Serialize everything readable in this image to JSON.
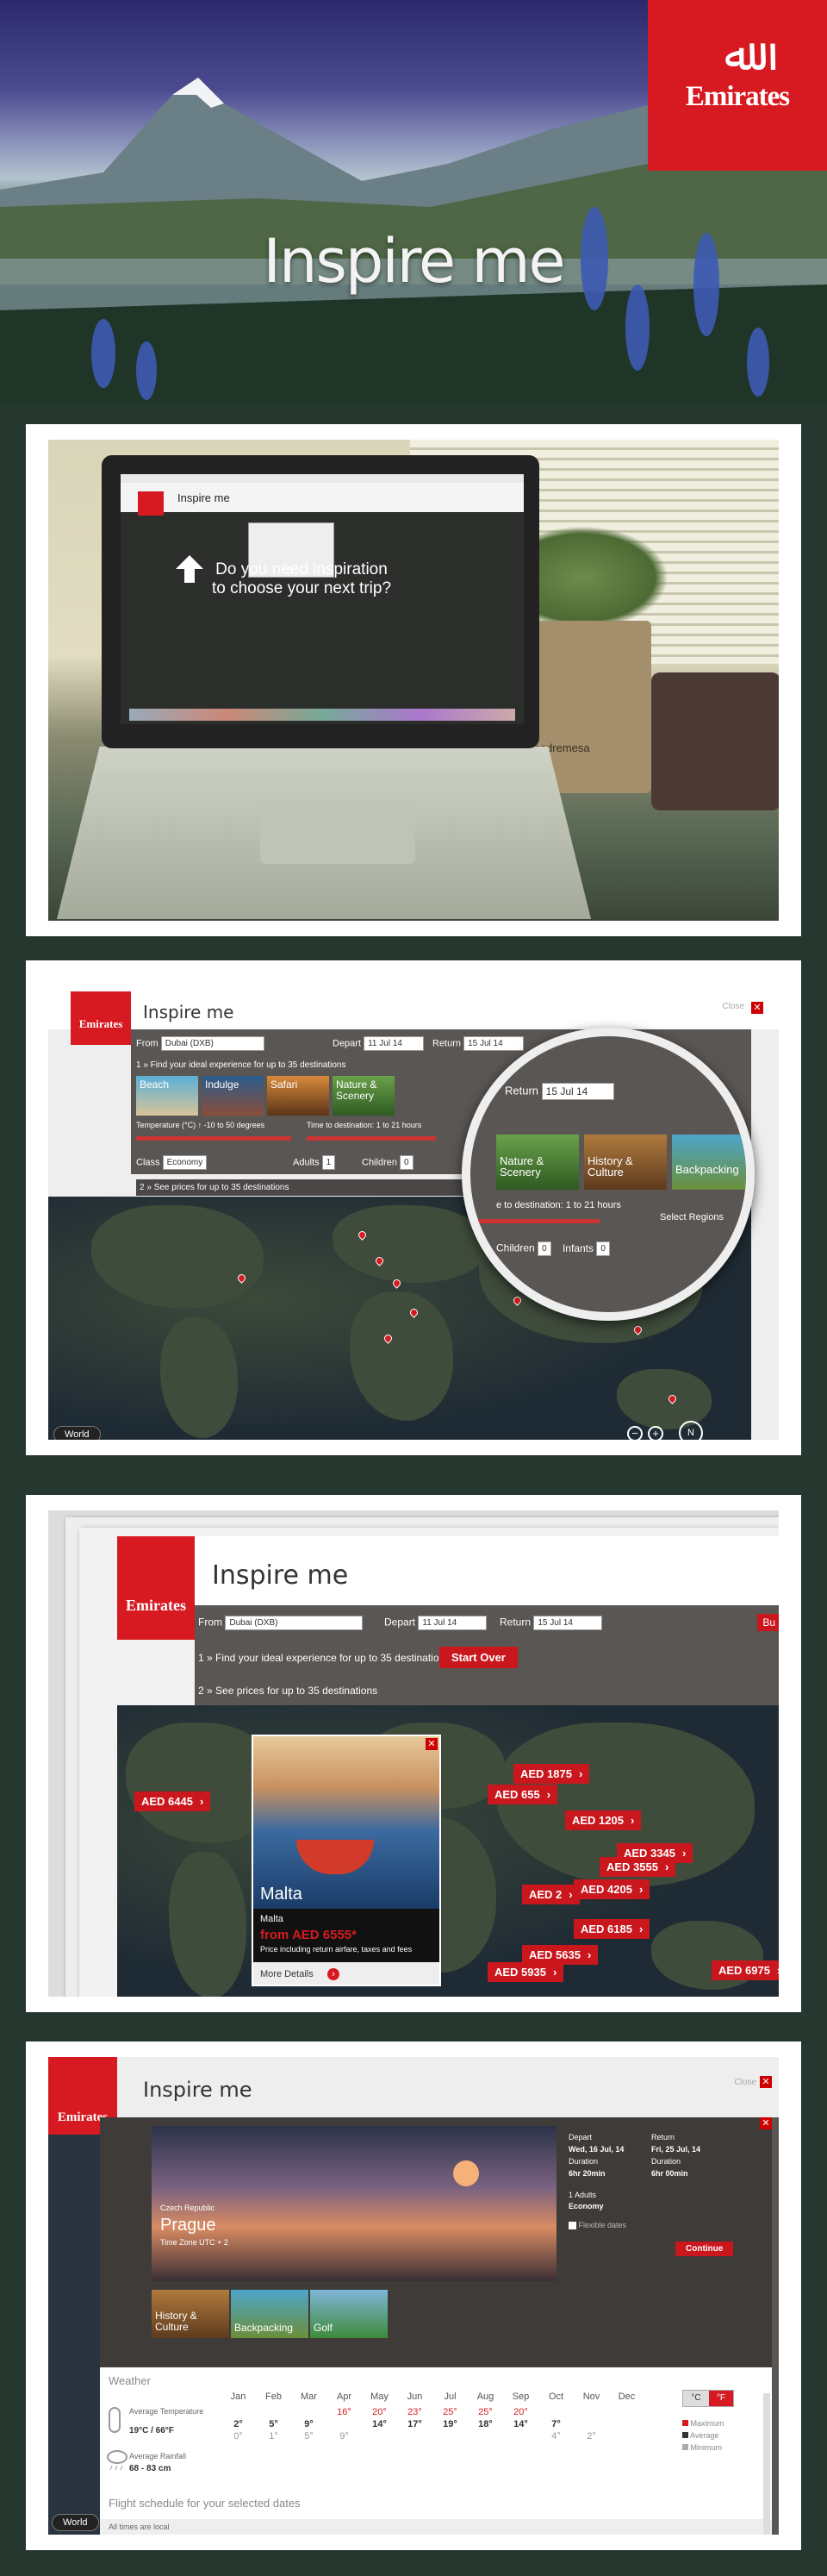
{
  "brand": {
    "name": "Emirates",
    "glyph": "ﷲ",
    "color": "#d71a21"
  },
  "hero": {
    "title": "Inspire me"
  },
  "panel1": {
    "screen_title": "Inspire me",
    "question": "Do you need inspiration to choose your next trip?",
    "pot_label": "madremesa"
  },
  "panel2": {
    "title": "Inspire me",
    "close_label": "Close",
    "from_label": "From",
    "from_value": "Dubai (DXB)",
    "depart_label": "Depart",
    "depart_value": "11 Jul 14",
    "return_label": "Return",
    "return_value": "15 Jul 14",
    "step1": "1 » Find your ideal experience for up to 35 destinations",
    "step2": "2 » See prices for up to 35 destinations",
    "experiences": [
      "Beach",
      "Indulge",
      "Safari",
      "Nature & Scenery"
    ],
    "zoom_experiences": [
      "Nature & Scenery",
      "History & Culture",
      "Backpacking"
    ],
    "temperature": "Temperature (°C) ↑ -10 to 50 degrees",
    "time_to_destination": "Time to destination: 1 to 21 hours",
    "zoom_time": "e to destination: 1 to 21 hours",
    "class_label": "Class",
    "class_value": "Economy",
    "adults_label": "Adults",
    "adults_value": "1",
    "children_label": "Children",
    "children_value": "0",
    "infants_label": "Infants",
    "infants_value": "0",
    "select_regions": "Select Regions",
    "world_button": "World"
  },
  "panel3": {
    "title": "Inspire me",
    "from_label": "From",
    "from_value": "Dubai (DXB)",
    "depart_label": "Depart",
    "depart_value": "11 Jul 14",
    "return_label": "Return",
    "return_value": "15 Jul 14",
    "step1": "1 » Find your ideal experience for up to 35 destinations",
    "step2": "2 » See prices for up to 35 destinations",
    "start_over": "Start Over",
    "currency_cut": "Bu",
    "popup": {
      "city_title": "Malta",
      "country": "Malta",
      "price": "from AED 6555*",
      "price_note": "Price including return airfare, taxes and fees",
      "more": "More Details"
    },
    "prices": [
      "AED 6445",
      "AED 1875",
      "AED 655",
      "AED 1205",
      "AED 3345",
      "AED 3555",
      "AED 2",
      "AED 4205",
      "AED 6185",
      "AED 5935",
      "AED 5635",
      "AED 6975"
    ]
  },
  "panel4": {
    "title": "Inspire me",
    "close_label": "Close",
    "country": "Czech Republic",
    "city": "Prague",
    "timezone": "Time Zone UTC + 2",
    "depart_label": "Depart",
    "depart_date": "Wed, 16 Jul, 14",
    "return_label": "Return",
    "return_date": "Fri, 25 Jul, 14",
    "duration_label": "Duration",
    "depart_duration": "6hr 20min",
    "return_duration": "6hr 00min",
    "passengers": "1 Adults",
    "cabin": "Economy",
    "flexible": "Flexible dates",
    "continue": "Continue",
    "experiences": [
      "History & Culture",
      "Backpacking",
      "Golf"
    ],
    "weather_title": "Weather",
    "months": [
      "Jan",
      "Feb",
      "Mar",
      "Apr",
      "May",
      "Jun",
      "Jul",
      "Aug",
      "Sep",
      "Oct",
      "Nov",
      "Dec"
    ],
    "avg_temp_label": "Average Temperature",
    "avg_temp_value": "19°C / 66°F",
    "max_row": [
      "",
      "",
      "",
      "16°",
      "20°",
      "23°",
      "25°",
      "25°",
      "20°",
      "",
      "",
      ""
    ],
    "avg_row": [
      "2°",
      "5°",
      "9°",
      "",
      "14°",
      "17°",
      "19°",
      "18°",
      "14°",
      "7°",
      "",
      ""
    ],
    "min_row": [
      "0°",
      "1°",
      "5°",
      "9°",
      "",
      "",
      "",
      "",
      "",
      "4°",
      "2°",
      ""
    ],
    "avg_rain_label": "Average Rainfall",
    "avg_rain_value": "68 - 83 cm",
    "unit_c": "°C",
    "unit_f": "°F",
    "legend": [
      "Maximum",
      "Average",
      "Minimum"
    ],
    "flight_schedule": "Flight schedule for your selected dates",
    "all_times": "All times are local",
    "world_button": "World"
  }
}
